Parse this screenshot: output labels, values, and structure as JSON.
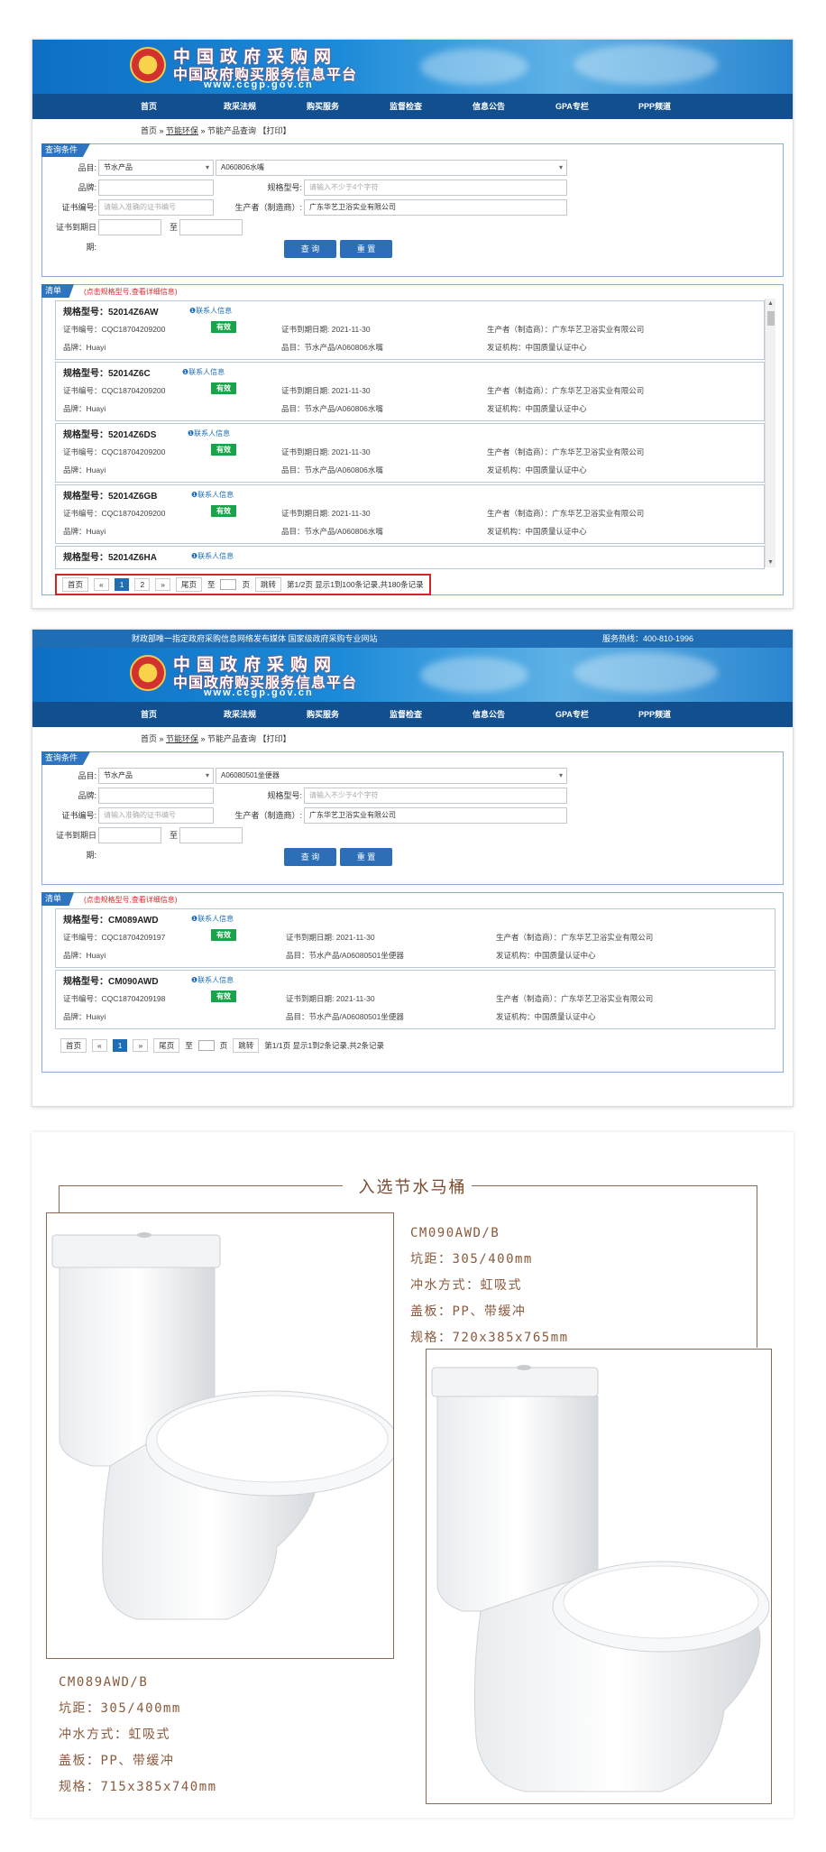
{
  "site": {
    "logo_cn": "中国政府采购网",
    "logo_sub": "中国政府购买服务信息平台",
    "url": "www.ccgp.gov.cn",
    "topbar_left": "财政部唯一指定政府采购信息网络发布媒体 国家级政府采购专业网站",
    "hotline": "服务热线：400-810-1996",
    "nav": [
      "首页",
      "政采法规",
      "购买服务",
      "监督检查",
      "信息公告",
      "GPA专栏",
      "PPP频道"
    ],
    "crumb_home": "首页",
    "crumb_sep": " » ",
    "crumb_link": "节能环保",
    "crumb_tail": " » 节能产品查询 【打印】"
  },
  "query": {
    "title": "查询条件",
    "category_label": "品目:",
    "brand_label": "品牌:",
    "model_label": "规格型号:",
    "model_placeholder": "请输入不少于4个字符",
    "cert_label": "证书编号:",
    "cert_placeholder": "请输入准确的证书编号",
    "maker_label": "生产者（制造商）:",
    "maker_value": "广东华艺卫浴实业有限公司",
    "expire_label": "证书到期日",
    "expire_to": "至",
    "expire_tail": "期:",
    "search_btn": "查 询",
    "reset_btn": "重 置"
  },
  "result_hint": "(点击规格型号,查看详细信息)",
  "list_title": "清单",
  "screen1": {
    "category": "节水产品",
    "subcategory": "A060806水嘴",
    "items": [
      {
        "model": "规格型号：52014Z6AW",
        "contact": "联系人信息",
        "cert": "证书编号：CQC18704209200",
        "status": "有效",
        "expire": "证书到期日期: 2021-11-30",
        "maker": "生产者（制造商）：广东华艺卫浴实业有限公司",
        "brand": "品牌：Huayi",
        "cat": "品目：节水产品/A060806水嘴",
        "org": "发证机构：中国质量认证中心"
      },
      {
        "model": "规格型号：52014Z6C",
        "contact": "联系人信息",
        "cert": "证书编号：CQC18704209200",
        "status": "有效",
        "expire": "证书到期日期: 2021-11-30",
        "maker": "生产者（制造商）：广东华艺卫浴实业有限公司",
        "brand": "品牌：Huayi",
        "cat": "品目：节水产品/A060806水嘴",
        "org": "发证机构：中国质量认证中心"
      },
      {
        "model": "规格型号：52014Z6DS",
        "contact": "联系人信息",
        "cert": "证书编号：CQC18704209200",
        "status": "有效",
        "expire": "证书到期日期: 2021-11-30",
        "maker": "生产者（制造商）：广东华艺卫浴实业有限公司",
        "brand": "品牌：Huayi",
        "cat": "品目：节水产品/A060806水嘴",
        "org": "发证机构：中国质量认证中心"
      },
      {
        "model": "规格型号：52014Z6GB",
        "contact": "联系人信息",
        "cert": "证书编号：CQC18704209200",
        "status": "有效",
        "expire": "证书到期日期: 2021-11-30",
        "maker": "生产者（制造商）：广东华艺卫浴实业有限公司",
        "brand": "品牌：Huayi",
        "cat": "品目：节水产品/A060806水嘴",
        "org": "发证机构：中国质量认证中心"
      },
      {
        "model": "规格型号：52014Z6HA",
        "contact": "联系人信息"
      }
    ],
    "pager": {
      "first": "首页",
      "prev": "«",
      "p1": "1",
      "p2": "2",
      "next": "»",
      "last": "尾页",
      "goto_pre": "至",
      "goto_post": "页",
      "jump": "跳转",
      "info": "第1/2页 显示1到100条记录,共180条记录"
    }
  },
  "screen2": {
    "category": "节水产品",
    "subcategory": "A06080501坐便器",
    "items": [
      {
        "model": "规格型号：CM089AWD",
        "contact": "联系人信息",
        "cert": "证书编号：CQC18704209197",
        "status": "有效",
        "expire": "证书到期日期: 2021-11-30",
        "maker": "生产者（制造商）：广东华艺卫浴实业有限公司",
        "brand": "品牌：Huayi",
        "cat": "品目：节水产品/A06080501坐便器",
        "org": "发证机构：中国质量认证中心"
      },
      {
        "model": "规格型号：CM090AWD",
        "contact": "联系人信息",
        "cert": "证书编号：CQC18704209198",
        "status": "有效",
        "expire": "证书到期日期: 2021-11-30",
        "maker": "生产者（制造商）：广东华艺卫浴实业有限公司",
        "brand": "品牌：Huayi",
        "cat": "品目：节水产品/A06080501坐便器",
        "org": "发证机构：中国质量认证中心"
      }
    ],
    "pager": {
      "first": "首页",
      "prev": "«",
      "p1": "1",
      "next": "»",
      "last": "尾页",
      "goto_pre": "至",
      "goto_post": "页",
      "jump": "跳转",
      "info": "第1/1页 显示1到2条记录,共2条记录"
    }
  },
  "promo": {
    "title": "入选节水马桶",
    "right": [
      "CM090AWD/B",
      "坑距：305/400mm",
      "冲水方式：虹吸式",
      "盖板：PP、带缓冲",
      "规格：720x385x765mm"
    ],
    "left": [
      "CM089AWD/B",
      "坑距：305/400mm",
      "冲水方式：虹吸式",
      "盖板：PP、带缓冲",
      "规格：715x385x740mm"
    ]
  }
}
